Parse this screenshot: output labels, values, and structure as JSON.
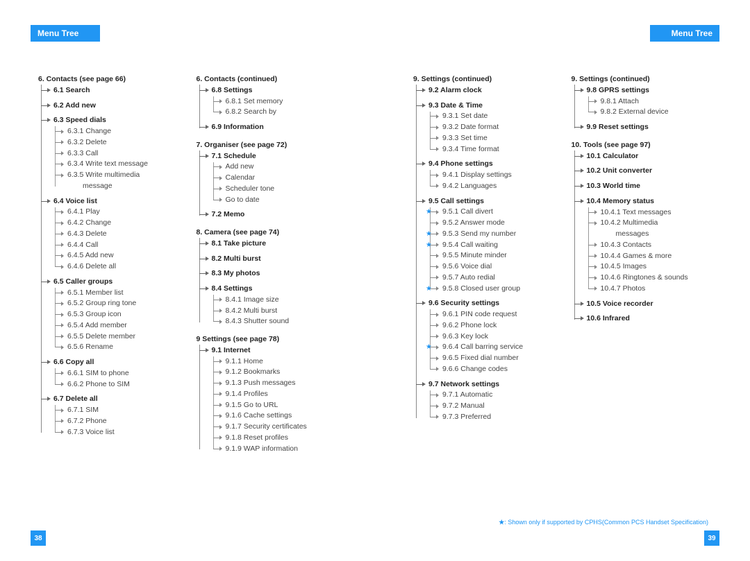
{
  "header": "Menu Tree",
  "pagenum_left": "38",
  "pagenum_right": "39",
  "footnote_star": "★",
  "footnote_text": ": Shown only if supported by CPHS(Common PCS Handset Specification)",
  "col1": {
    "s1": {
      "title": "6. Contacts (see page 66)",
      "i1": "6.1 Search",
      "i2": "6.2 Add new",
      "i3": {
        "t": "6.3 Speed dials",
        "c1": "6.3.1 Change",
        "c2": "6.3.2 Delete",
        "c3": "6.3.3 Call",
        "c4": "6.3.4 Write text message",
        "c5a": "6.3.5 Write multimedia",
        "c5b": "message"
      },
      "i4": {
        "t": "6.4 Voice list",
        "c1": "6.4.1 Play",
        "c2": "6.4.2 Change",
        "c3": "6.4.3 Delete",
        "c4": "6.4.4 Call",
        "c5": "6.4.5 Add new",
        "c6": "6.4.6 Delete all"
      },
      "i5": {
        "t": "6.5 Caller groups",
        "c1": "6.5.1 Member list",
        "c2": "6.5.2 Group ring tone",
        "c3": "6.5.3 Group icon",
        "c4": "6.5.4 Add member",
        "c5": "6.5.5 Delete member",
        "c6": "6.5.6 Rename"
      },
      "i6": {
        "t": "6.6 Copy all",
        "c1": "6.6.1 SIM to phone",
        "c2": "6.6.2 Phone to SIM"
      },
      "i7": {
        "t": "6.7 Delete all",
        "c1": "6.7.1 SIM",
        "c2": "6.7.2 Phone",
        "c3": "6.7.3 Voice list"
      }
    }
  },
  "col2": {
    "s1": {
      "title": "6. Contacts (continued)",
      "i8": {
        "t": "6.8 Settings",
        "c1": "6.8.1 Set memory",
        "c2": "6.8.2 Search by"
      },
      "i9": "6.9 Information"
    },
    "s2": {
      "title": "7. Organiser (see page 72)",
      "i1": {
        "t": "7.1 Schedule",
        "c1": "Add new",
        "c2": "Calendar",
        "c3": "Scheduler tone",
        "c4": "Go to date"
      },
      "i2": "7.2 Memo"
    },
    "s3": {
      "title": "8. Camera (see page 74)",
      "i1": "8.1 Take picture",
      "i2": "8.2 Multi burst",
      "i3": "8.3 My photos",
      "i4": {
        "t": "8.4 Settings",
        "c1": "8.4.1 Image size",
        "c2": "8.4.2 Multi burst",
        "c3": "8.4.3 Shutter sound"
      }
    },
    "s4": {
      "title": "9 Settings (see page 78)",
      "i1": {
        "t": "9.1 Internet",
        "c1": "9.1.1 Home",
        "c2": "9.1.2 Bookmarks",
        "c3": "9.1.3 Push messages",
        "c4": "9.1.4 Profiles",
        "c5": "9.1.5 Go to URL",
        "c6": "9.1.6 Cache settings",
        "c7": "9.1.7 Security certificates",
        "c8": "9.1.8 Reset profiles",
        "c9": "9.1.9 WAP information"
      }
    }
  },
  "col3": {
    "s1": {
      "title": "9. Settings (continued)",
      "i2": "9.2 Alarm clock",
      "i3": {
        "t": "9.3 Date & Time",
        "c1": "9.3.1 Set date",
        "c2": "9.3.2 Date format",
        "c3": "9.3.3 Set time",
        "c4": "9.3.4 Time format"
      },
      "i4": {
        "t": "9.4 Phone settings",
        "c1": "9.4.1 Display settings",
        "c2": "9.4.2 Languages"
      },
      "i5": {
        "t": "9.5 Call settings",
        "c1": "9.5.1 Call divert",
        "c2": "9.5.2 Answer mode",
        "c3": "9.5.3 Send my number",
        "c4": "9.5.4 Call waiting",
        "c5": "9.5.5 Minute minder",
        "c6": "9.5.6 Voice dial",
        "c7": "9.5.7 Auto redial",
        "c8": "9.5.8 Closed user group"
      },
      "i6": {
        "t": "9.6 Security settings",
        "c1": "9.6.1 PIN code request",
        "c2": "9.6.2 Phone lock",
        "c3": "9.6.3 Key lock",
        "c4": "9.6.4 Call barring service",
        "c5": "9.6.5 Fixed dial number",
        "c6": "9.6.6 Change codes"
      },
      "i7": {
        "t": "9.7 Network settings",
        "c1": "9.7.1 Automatic",
        "c2": "9.7.2 Manual",
        "c3": "9.7.3 Preferred"
      }
    }
  },
  "col4": {
    "s1": {
      "title": "9. Settings (continued)",
      "i8": {
        "t": "9.8 GPRS settings",
        "c1": "9.8.1 Attach",
        "c2": "9.8.2 External device"
      },
      "i9": "9.9 Reset settings"
    },
    "s2": {
      "title": "10. Tools (see page 97)",
      "i1": "10.1 Calculator",
      "i2": "10.2 Unit converter",
      "i3": "10.3 World time",
      "i4": {
        "t": "10.4 Memory status",
        "c1": "10.4.1 Text messages",
        "c2a": "10.4.2 Multimedia",
        "c2b": "messages",
        "c3": "10.4.3 Contacts",
        "c4": "10.4.4 Games & more",
        "c5": "10.4.5 Images",
        "c6": "10.4.6 Ringtones & sounds",
        "c7": "10.4.7 Photos"
      },
      "i5": "10.5 Voice recorder",
      "i6": "10.6 Infrared"
    }
  }
}
